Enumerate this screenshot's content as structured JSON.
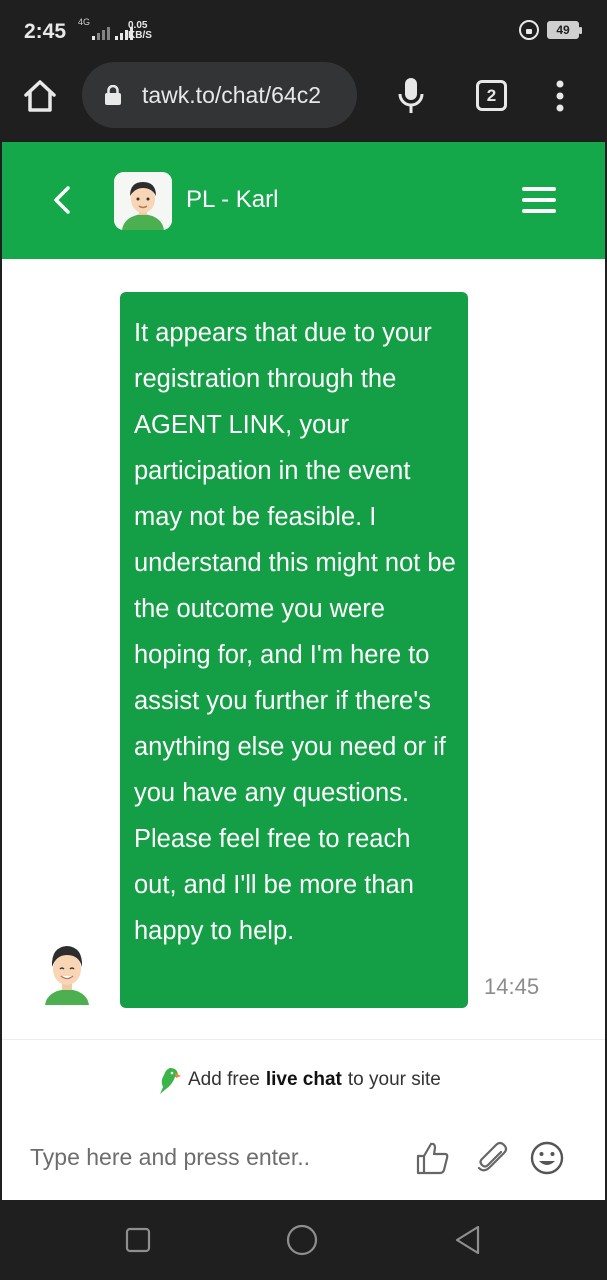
{
  "status_bar": {
    "time": "2:45",
    "network_type": "4G",
    "speed_value": "0.05",
    "speed_unit": "KB/S",
    "battery": "49"
  },
  "browser": {
    "url": "tawk.to/chat/64c2",
    "tab_count": "2"
  },
  "chat_header": {
    "agent_name": "PL - Karl"
  },
  "message": {
    "text": "It appears that due to your registration through the AGENT LINK, your participation in the event may not be feasible. I understand this might not be the outcome you were hoping for, and I'm here to assist you further if there's anything else you need or if you have any questions. Please feel free to reach out, and I'll be more than happy to help.",
    "time": "14:45"
  },
  "branding": {
    "prefix": "Add free",
    "bold": "live chat",
    "suffix": "to your site"
  },
  "input": {
    "placeholder": "Type here and press enter.."
  },
  "colors": {
    "brand_green": "#15a84a",
    "bubble_green": "#149f46",
    "system_bar": "#1f1f1f"
  },
  "icons": [
    "home-icon",
    "lock-icon",
    "mic-icon",
    "tabs-icon",
    "more-vert-icon",
    "back-chevron-icon",
    "hamburger-menu-icon",
    "thumbs-up-icon",
    "paperclip-icon",
    "emoji-icon",
    "recents-icon",
    "home-circle-icon",
    "back-triangle-icon"
  ]
}
